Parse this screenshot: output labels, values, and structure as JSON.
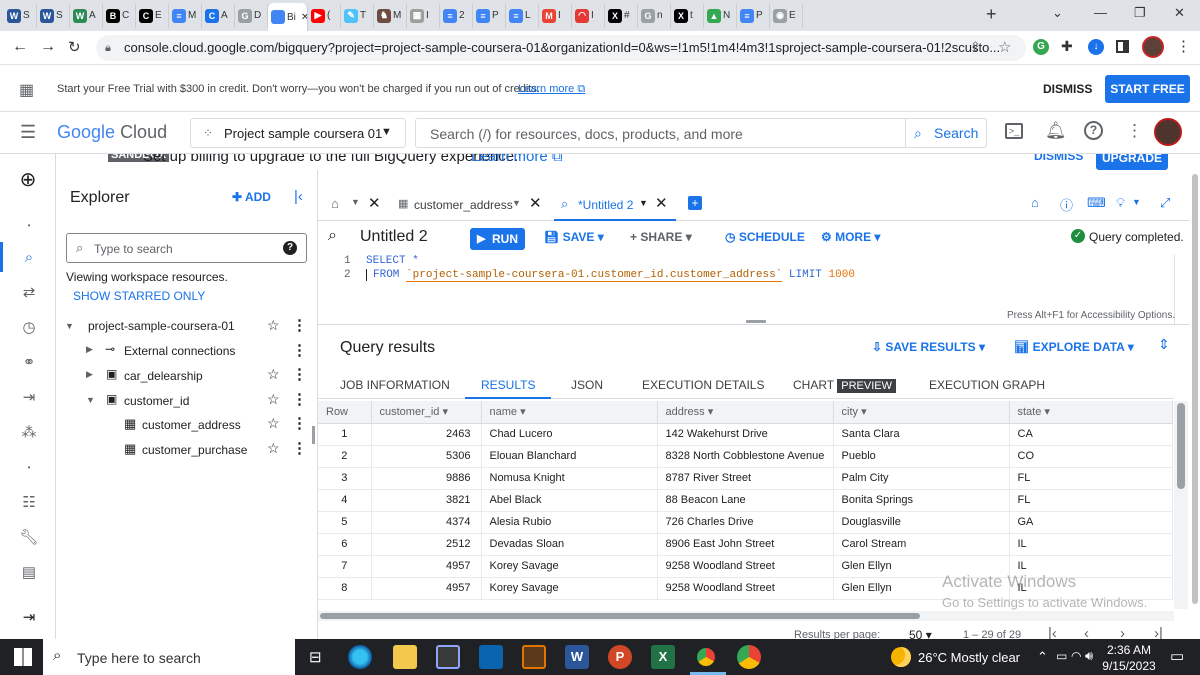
{
  "browser": {
    "tabs": [
      {
        "label": "S",
        "fav": "W",
        "color": "#2b579a"
      },
      {
        "label": "S",
        "fav": "W",
        "color": "#2b579a"
      },
      {
        "label": "A",
        "fav": "W",
        "color": "#2e8b57"
      },
      {
        "label": "C",
        "fav": "B",
        "color": "#000000"
      },
      {
        "label": "E",
        "fav": "C",
        "color": "#000000"
      },
      {
        "label": "M",
        "fav": "≡",
        "color": "#4285f4"
      },
      {
        "label": "A",
        "fav": "C",
        "color": "#1a73e8"
      },
      {
        "label": "D",
        "fav": "G",
        "color": "#9aa0a6"
      },
      {
        "label": "Bi",
        "fav": "",
        "color": "#4285f4",
        "active": true
      },
      {
        "label": "(",
        "fav": "▶",
        "color": "#ff0000"
      },
      {
        "label": "T",
        "fav": "✎",
        "color": "#4fc3f7"
      },
      {
        "label": "M",
        "fav": "♞",
        "color": "#6d4c41"
      },
      {
        "label": "I",
        "fav": "▦",
        "color": "#9e9e9e"
      },
      {
        "label": "2",
        "fav": "≡",
        "color": "#4285f4"
      },
      {
        "label": "P",
        "fav": "≡",
        "color": "#4285f4"
      },
      {
        "label": "L",
        "fav": "≡",
        "color": "#4285f4"
      },
      {
        "label": "I",
        "fav": "M",
        "color": "#ea4335"
      },
      {
        "label": "I",
        "fav": "◠",
        "color": "#e53935"
      },
      {
        "label": "#",
        "fav": "X",
        "color": "#000000"
      },
      {
        "label": "n",
        "fav": "G",
        "color": "#9aa0a6"
      },
      {
        "label": "t",
        "fav": "X",
        "color": "#000000"
      },
      {
        "label": "N",
        "fav": "▲",
        "color": "#34a853"
      },
      {
        "label": "P",
        "fav": "≡",
        "color": "#4285f4"
      },
      {
        "label": "E",
        "fav": "◉",
        "color": "#9aa0a6"
      }
    ],
    "url": "console.cloud.google.com/bigquery?project=project-sample-coursera-01&organizationId=0&ws=!1m5!1m4!4m3!1sproject-sample-coursera-01!2scusto..."
  },
  "trial": {
    "text": "Start your Free Trial with $300 in credit. Don't worry—you won't be charged if you run out of credits.",
    "learn_more": "Learn more",
    "dismiss": "DISMISS",
    "start_free": "START FREE"
  },
  "header": {
    "logo_google": "Google",
    "logo_cloud": "Cloud",
    "project": "Project sample coursera 01",
    "search_placeholder": "Search (/) for resources, docs, products, and more",
    "search_button": "Search"
  },
  "sandbox": {
    "badge": "SANDBOX",
    "text": "Set up billing to upgrade to the full BigQuery experience.",
    "learn_more": "Learn more",
    "dismiss": "DISMISS",
    "upgrade": "UPGRADE"
  },
  "explorer": {
    "title": "Explorer",
    "add": "ADD",
    "search_placeholder": "Type to search",
    "viewing": "Viewing workspace resources.",
    "show_starred": "SHOW STARRED ONLY",
    "project": "project-sample-coursera-01",
    "items": [
      {
        "label": "External connections"
      },
      {
        "label": "car_delearship"
      },
      {
        "label": "customer_id"
      },
      {
        "label": "customer_address"
      },
      {
        "label": "customer_purchase"
      }
    ]
  },
  "editor": {
    "tab1": "customer_address",
    "tab2": "*Untitled 2",
    "title": "Untitled 2",
    "run": "RUN",
    "save": "SAVE",
    "share": "SHARE",
    "schedule": "SCHEDULE",
    "more": "MORE",
    "status": "Query completed.",
    "line1": "1",
    "line2": "2",
    "code1": "SELECT *",
    "code2_kw": "FROM",
    "code2_table": "`project-sample-coursera-01.customer_id.customer_address`",
    "code2_limit": "LIMIT",
    "code2_num": "1000",
    "accessibility": "Press Alt+F1 for Accessibility Options."
  },
  "results": {
    "title": "Query results",
    "save_results": "SAVE RESULTS",
    "explore_data": "EXPLORE DATA",
    "tabs": [
      "JOB INFORMATION",
      "RESULTS",
      "JSON",
      "EXECUTION DETAILS",
      "CHART",
      "EXECUTION GRAPH"
    ],
    "preview_badge": "PREVIEW",
    "columns": [
      "Row",
      "customer_id",
      "name",
      "address",
      "city",
      "state"
    ],
    "rows": [
      [
        "1",
        "2463",
        "Chad Lucero",
        "142 Wakehurst Drive",
        "Santa Clara",
        "CA"
      ],
      [
        "2",
        "5306",
        "Elouan Blanchard",
        "8328 North Cobblestone Avenue",
        "Pueblo",
        "CO"
      ],
      [
        "3",
        "9886",
        "Nomusa Knight",
        "8787 River Street",
        "Palm City",
        "FL"
      ],
      [
        "4",
        "3821",
        "Abel Black",
        "88 Beacon Lane",
        "Bonita Springs",
        "FL"
      ],
      [
        "5",
        "4374",
        "Alesia Rubio",
        "726 Charles Drive",
        "Douglasville",
        "GA"
      ],
      [
        "6",
        "2512",
        "Devadas Sloan",
        "8906 East John Street",
        "Carol Stream",
        "IL"
      ],
      [
        "7",
        "4957",
        "Korey Savage",
        "9258 Woodland Street",
        "Glen Ellyn",
        "IL"
      ],
      [
        "8",
        "4957",
        "Korey Savage",
        "9258 Woodland Street",
        "Glen Ellyn",
        "IL"
      ]
    ],
    "results_per_page": "Results per page:",
    "per_page": "50",
    "range": "1 – 29 of 29"
  },
  "watermark": {
    "line1": "Activate Windows",
    "line2": "Go to Settings to activate Windows."
  },
  "taskbar": {
    "search_placeholder": "Type here to search",
    "weather": "26°C  Mostly clear",
    "time": "2:36 AM",
    "date": "9/15/2023"
  }
}
